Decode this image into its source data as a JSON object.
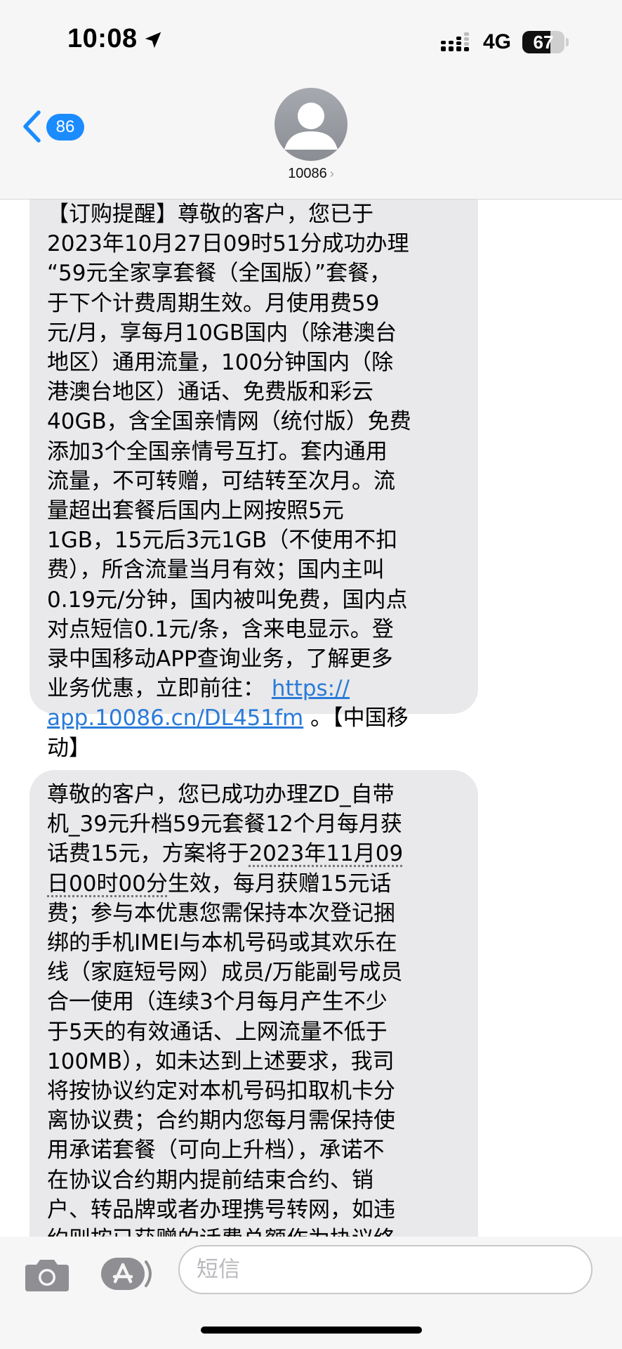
{
  "status_bar": {
    "time": "10:08",
    "network": "4G",
    "battery_percent": "67",
    "battery_level": 0.67
  },
  "header": {
    "back_badge_count": "86",
    "contact_name": "10086",
    "contact_chevron": "›",
    "icons": [
      "chevron-left-icon",
      "location-arrow-icon",
      "signal-icon",
      "battery-icon",
      "person-icon"
    ]
  },
  "messages": [
    {
      "sender": "10086",
      "lines": [
        "【订购提醒】尊敬的客户，您已于",
        "2023年10月27日09时51分成功办理",
        "“59元全家享套餐（全国版）”套餐，",
        "于下个计费周期生效。月使用费59",
        "元/月，享每月10GB国内（除港澳台",
        "地区）通用流量，100分钟国内（除",
        "港澳台地区）通话、免费版和彩云",
        "40GB，含全国亲情网（统付版）免费",
        "添加3个全国亲情号互打。套内通用",
        "流量，不可转赠，可结转至次月。流",
        "量超出套餐后国内上网按照5元",
        "1GB，15元后3元1GB（不使用不扣",
        "费），所含流量当月有效；国内主叫",
        "0.19元/分钟，国内被叫免费，国内点",
        "对点短信0.1元/条，含来电显示。登",
        "录中国移动APP查询业务，了解更多"
      ],
      "link_prefix": "业务优惠，立即前往：",
      "link_part1": "https://",
      "link_part2": "app.10086.cn/DL451fm",
      "after_link": " 。【中国移",
      "last_line": "动】"
    },
    {
      "sender": "10086",
      "lines_top": [
        "尊敬的客户，您已成功办理ZD_自带",
        "机_39元升档59元套餐12个月每月获"
      ],
      "line3_prefix": "话费15元，方案将于",
      "date_part1": "2023年11月09",
      "date_part2": "日00时00分",
      "line4_suffix": "生效，每月获赠15元话",
      "lines_rest": [
        "费；参与本优惠您需保持本次登记捆",
        "绑的手机IMEI与本机号码或其欢乐在",
        "线（家庭短号网）成员/万能副号成员",
        "合一使用（连续3个月每月产生不少",
        "于5天的有效通话、上网流量不低于",
        "100MB），如未达到上述要求，我司",
        "将按协议约定对本机号码扣取机卡分",
        "离协议费；合约期内您每月需保持使",
        "用承诺套餐（可向上升档），承诺不",
        "在协议合约期内提前结束合约、销",
        "户、转品牌或者办理携号转网，如违",
        "约则按已获赠的话费总额作为协议终"
      ]
    }
  ],
  "input_bar": {
    "placeholder": "短信",
    "icons": [
      "camera-icon",
      "app-store-icon"
    ]
  },
  "colors": {
    "accent": "#1a8cff",
    "bubble_gray": "#e9e9eb",
    "link": "#2a7bd8",
    "bar_background": "#f6f6f6"
  }
}
